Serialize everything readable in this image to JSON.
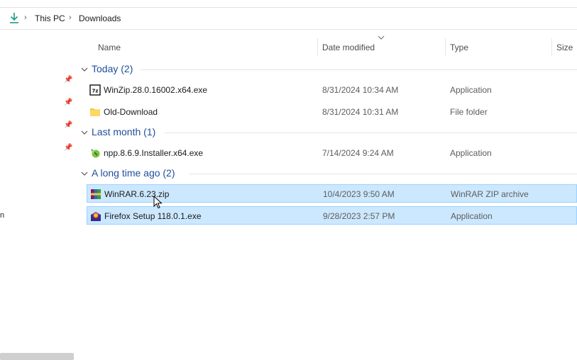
{
  "breadcrumb": {
    "items": [
      "This PC",
      "Downloads"
    ]
  },
  "nav": {
    "fragment": "n"
  },
  "columns": {
    "name": "Name",
    "date": "Date modified",
    "type": "Type",
    "size": "Size"
  },
  "groups": [
    {
      "label": "Today (2)",
      "items": [
        {
          "name": "WinZip.28.0.16002.x64.exe",
          "date": "8/31/2024 10:34 AM",
          "type": "Application",
          "icon": "winzip-icon"
        },
        {
          "name": "Old-Download",
          "date": "8/31/2024 10:31 AM",
          "type": "File folder",
          "icon": "folder-icon"
        }
      ]
    },
    {
      "label": "Last month (1)",
      "items": [
        {
          "name": "npp.8.6.9.Installer.x64.exe",
          "date": "7/14/2024 9:24 AM",
          "type": "Application",
          "icon": "notepadpp-icon"
        }
      ]
    },
    {
      "label": "A long time ago (2)",
      "items": [
        {
          "name": "WinRAR.6.23.zip",
          "date": "10/4/2023 9:50 AM",
          "type": "WinRAR ZIP archive",
          "icon": "winrar-icon",
          "selected": true
        },
        {
          "name": "Firefox Setup 118.0.1.exe",
          "date": "9/28/2023 2:57 PM",
          "type": "Application",
          "icon": "firefox-icon",
          "selected": true
        }
      ]
    }
  ],
  "colors": {
    "group_label": "#1f4e9a",
    "selection_bg": "#cce8ff",
    "selection_border": "#99d1ff"
  }
}
